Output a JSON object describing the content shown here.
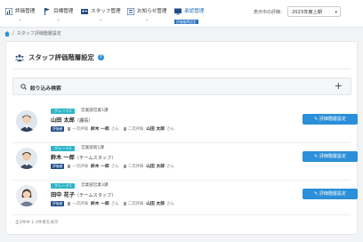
{
  "nav": {
    "items": [
      {
        "label": "評価管理",
        "icon": "chart-icon"
      },
      {
        "label": "目標管理",
        "icon": "flag-icon"
      },
      {
        "label": "スタッフ管理",
        "icon": "id-card-icon"
      },
      {
        "label": "お知らせ管理",
        "icon": "bulletin-icon"
      },
      {
        "label": "承認管理",
        "icon": "monitor-icon",
        "badge": "評価階層設定",
        "active": true
      }
    ],
    "period_label": "表示中の評価：",
    "period_value": "2023年度上期"
  },
  "breadcrumb": {
    "separator": "/",
    "current": "スタッフ評価階層設定"
  },
  "page": {
    "title": "スタッフ評価階層設定",
    "help": "?",
    "search_label": "絞り込み検索",
    "plus": "+",
    "footer": "全3件中 1-3件目を表示"
  },
  "staff": [
    {
      "grade": "グレード1",
      "dept": "営業部営業1課",
      "name": "山田 太郎",
      "role": "（課長）",
      "tag": "評価者",
      "first_label": "一次評価",
      "first_name": "鈴木 一郎",
      "second_label": "二次評価",
      "second_name": "山田 太郎",
      "honorific": "さん",
      "button": "評価階層設定"
    },
    {
      "grade": "グレード2",
      "dept": "営業部第1課",
      "name": "鈴木 一郎",
      "role": "（チームスタッフ）",
      "tag": "評価者",
      "first_label": "一次評価",
      "first_name": "鈴木 一郎",
      "second_label": "二次評価",
      "second_name": "山田 太郎",
      "honorific": "さん",
      "button": "評価階層設定"
    },
    {
      "grade": "グレード1",
      "dept": "営業部営業3課",
      "name": "田中 花子",
      "role": "（チームスタッフ）",
      "tag": "評価者",
      "first_label": "一次評価",
      "first_name": "鈴木 一郎",
      "second_label": "二次評価",
      "second_name": "山田 太郎",
      "honorific": "さん",
      "button": "評価階層設定"
    }
  ],
  "colors": {
    "accent": "#2b8fd9",
    "grade": "#2fb6c8",
    "tag": "#1f4e8c"
  }
}
